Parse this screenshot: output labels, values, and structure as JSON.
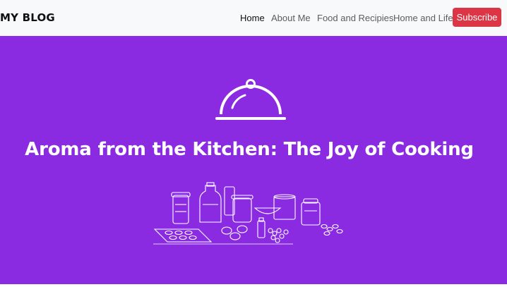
{
  "navbar": {
    "brand": "MY BLOG",
    "links": [
      {
        "label": "Home",
        "active": true
      },
      {
        "label": "About Me",
        "active": false
      },
      {
        "label": "Food and Recipies",
        "active": false
      },
      {
        "label": "Home and Life",
        "active": false
      }
    ],
    "subscribe_label": "Subscribe",
    "subscribe_color": "#dc3545"
  },
  "hero": {
    "background": "#8a2be2",
    "icon": "cloche-icon",
    "title": "Aroma from the Kitchen: The Joy of Cooking",
    "illustration": "kitchen-ingredients-illustration"
  }
}
